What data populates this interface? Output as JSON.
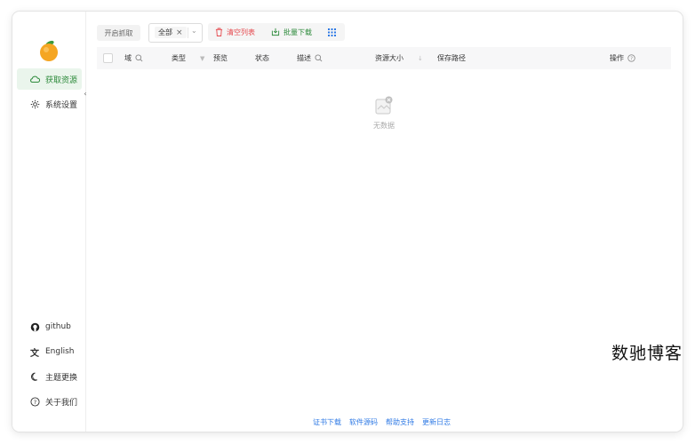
{
  "window": {
    "controls": [
      "close",
      "minimize",
      "maximize"
    ]
  },
  "sidebar": {
    "logo_icon": "orange-icon",
    "items": [
      {
        "label": "获取资源",
        "icon": "cloud-icon",
        "active": true
      },
      {
        "label": "系统设置",
        "icon": "gear-icon",
        "active": false
      }
    ],
    "bottom_items": [
      {
        "label": "github",
        "icon": "github-icon"
      },
      {
        "label": "English",
        "icon": "translate-icon"
      },
      {
        "label": "主题更换",
        "icon": "moon-icon"
      },
      {
        "label": "关于我们",
        "icon": "help-circle-icon"
      }
    ]
  },
  "toolbar": {
    "start_label": "开启抓取",
    "filter_selected": "全部",
    "clear_label": "清空列表",
    "batch_label": "批量下载",
    "colors": {
      "clear": "#e5484d",
      "batch": "#2e8b3c",
      "grid": "#2f7ae5"
    }
  },
  "table": {
    "columns": [
      "域",
      "类型",
      "预览",
      "状态",
      "描述",
      "资源大小",
      "保存路径",
      "操作"
    ]
  },
  "empty": {
    "text": "无数据"
  },
  "footer": {
    "links": [
      "证书下载",
      "软件源码",
      "帮助支持",
      "更新日志"
    ]
  },
  "watermark": "数驰博客",
  "accent": "#2e8b3c"
}
